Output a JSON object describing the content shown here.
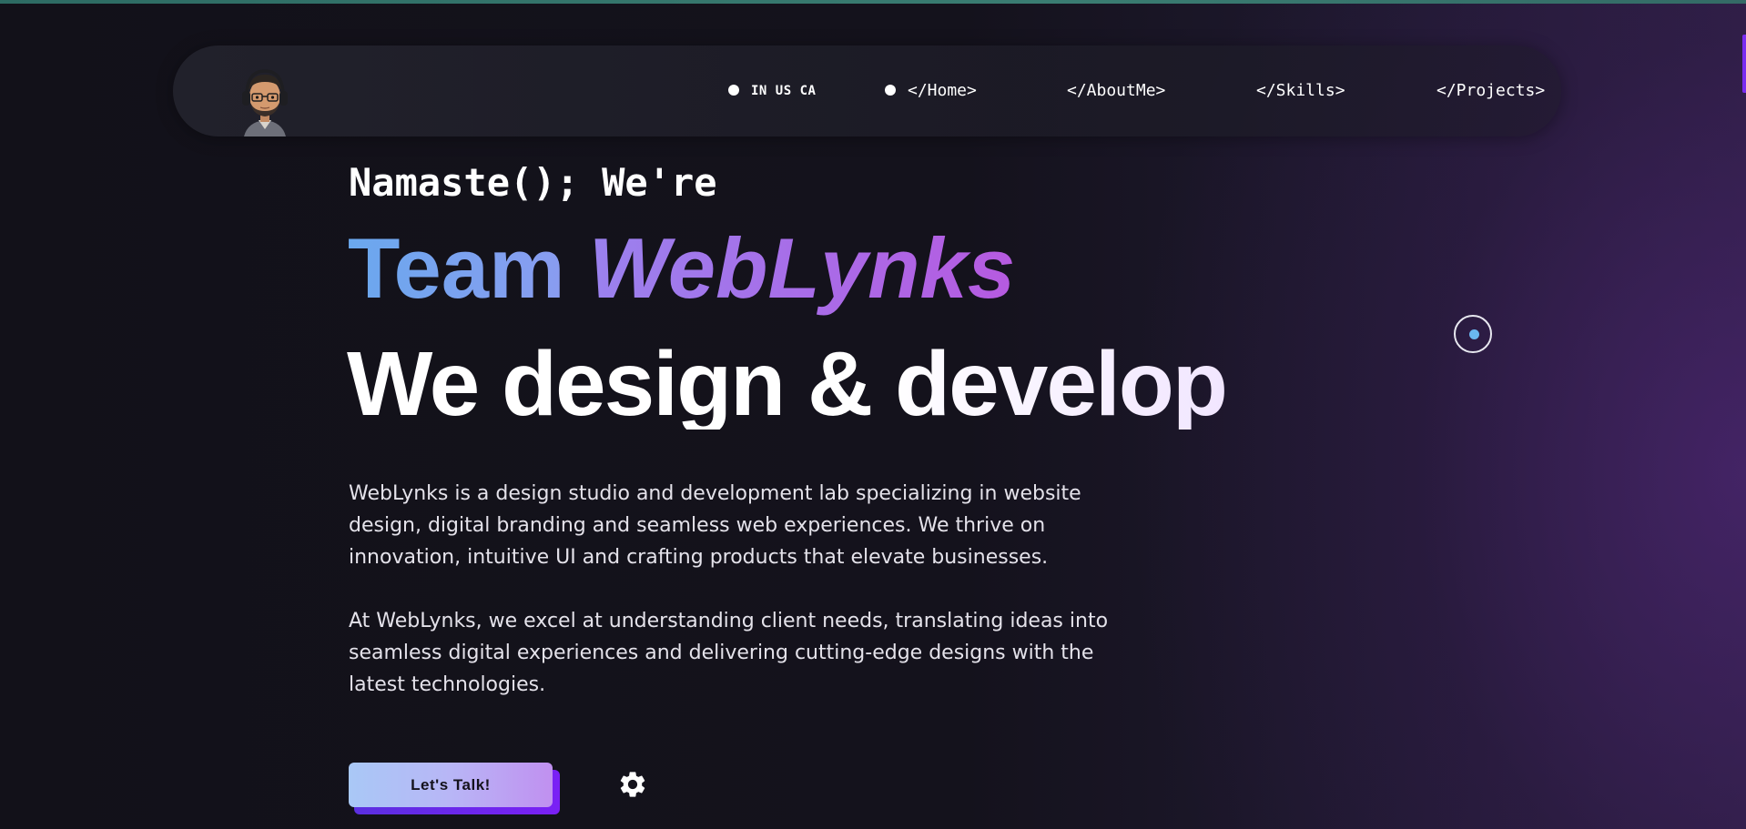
{
  "nav": {
    "avatar_icon": "memoji-avatar-with-headphones",
    "languages": "IN US CA",
    "links": [
      {
        "label": "</Home>"
      },
      {
        "label": "</AboutMe>"
      },
      {
        "label": "</Skills>"
      },
      {
        "label": "</Projects>"
      }
    ]
  },
  "hero": {
    "greeting": "Namaste(); We're",
    "team_word": "Team",
    "brand_word": "WebLynks",
    "tagline": "We design & develop",
    "paragraph1": "WebLynks is a design studio and development lab specializing in website design, digital branding and seamless web experiences. We thrive on innovation, intuitive UI and crafting products that elevate businesses.",
    "paragraph2": "At WebLynks, we excel at understanding client needs, translating ideas into seamless digital experiences and delivering cutting-edge designs with the latest technologies.",
    "cta_label": "Let's Talk!",
    "settings_icon": "gear-icon"
  },
  "colors": {
    "background": "#12111a",
    "accent_purple": "#7a20f5",
    "gradient_blue": "#6aa8ee",
    "gradient_violet": "#b65ae0",
    "top_line": "#3a7d72"
  }
}
